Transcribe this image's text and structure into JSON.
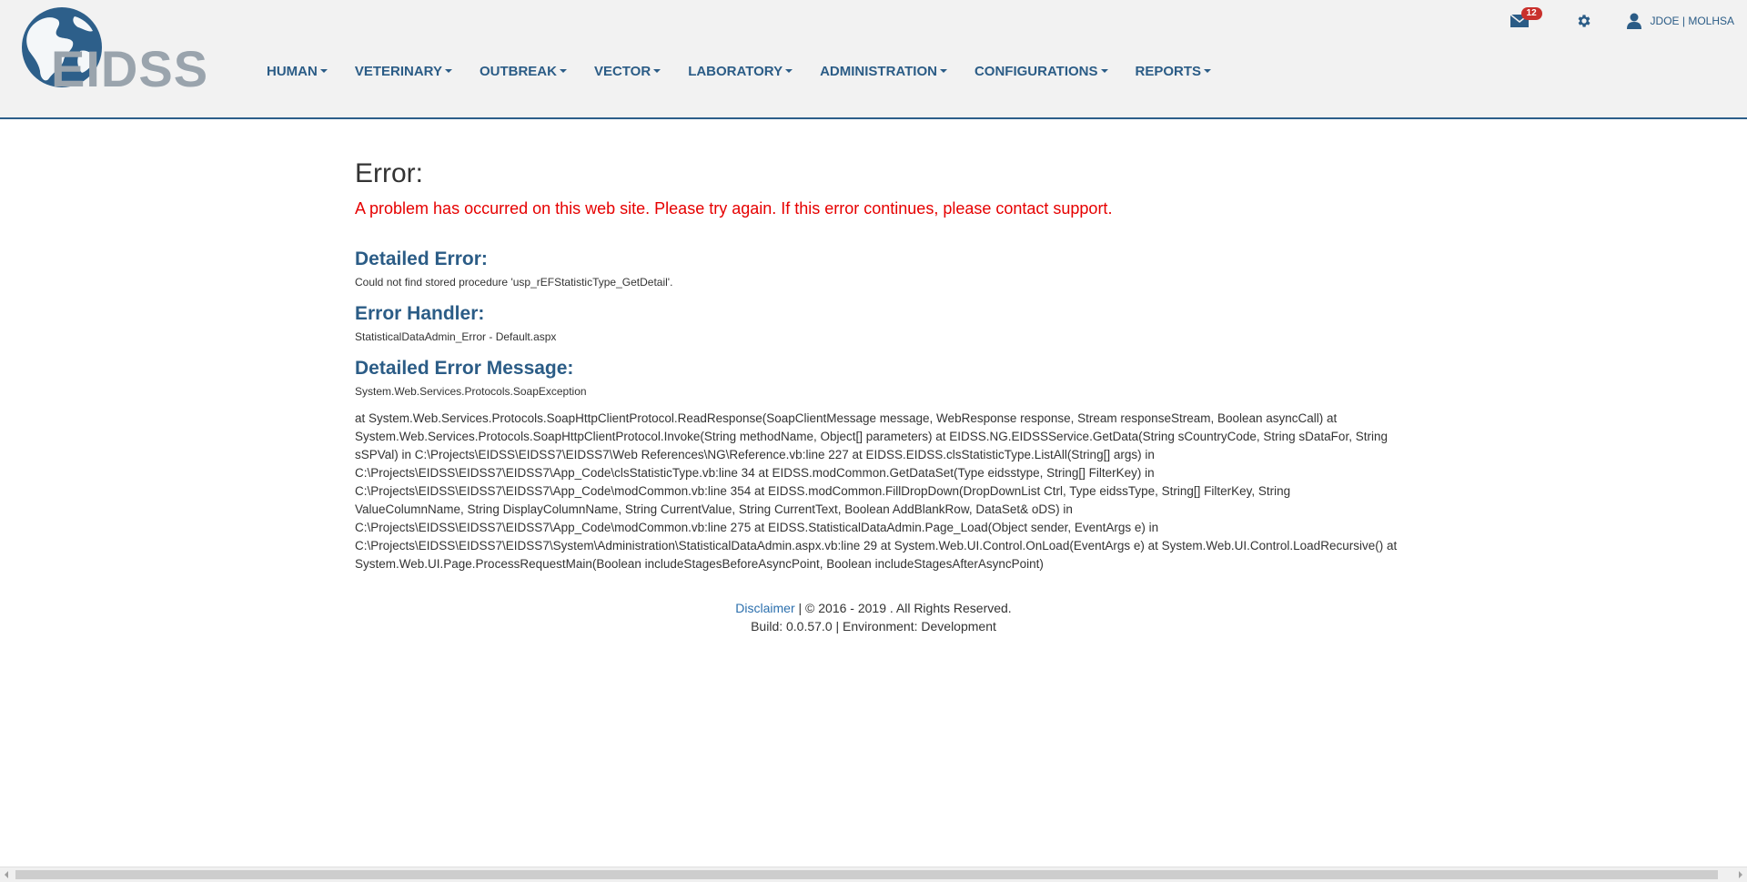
{
  "app": {
    "logo_text": "EIDSS"
  },
  "nav": {
    "items": [
      {
        "label": "HUMAN"
      },
      {
        "label": "VETERINARY"
      },
      {
        "label": "OUTBREAK"
      },
      {
        "label": "VECTOR"
      },
      {
        "label": "LABORATORY"
      },
      {
        "label": "ADMINISTRATION"
      },
      {
        "label": "CONFIGURATIONS"
      },
      {
        "label": "REPORTS"
      }
    ]
  },
  "topbar": {
    "mail_badge": "12",
    "user_label": "JDOE | MOLHSA"
  },
  "error": {
    "title": "Error:",
    "message": "A problem has occurred on this web site. Please try again. If this error continues, please contact support.",
    "detailed_error_heading": "Detailed Error:",
    "detailed_error_text": "Could not find stored procedure 'usp_rEFStatisticType_GetDetail'.",
    "handler_heading": "Error Handler:",
    "handler_text": "StatisticalDataAdmin_Error - Default.aspx",
    "detailed_message_heading": "Detailed Error Message:",
    "detailed_message_type": "System.Web.Services.Protocols.SoapException",
    "stack_trace": "at System.Web.Services.Protocols.SoapHttpClientProtocol.ReadResponse(SoapClientMessage message, WebResponse response, Stream responseStream, Boolean asyncCall) at System.Web.Services.Protocols.SoapHttpClientProtocol.Invoke(String methodName, Object[] parameters) at EIDSS.NG.EIDSSService.GetData(String sCountryCode, String sDataFor, String sSPVal) in C:\\Projects\\EIDSS\\EIDSS7\\EIDSS7\\Web References\\NG\\Reference.vb:line 227 at EIDSS.EIDSS.clsStatisticType.ListAll(String[] args) in C:\\Projects\\EIDSS\\EIDSS7\\EIDSS7\\App_Code\\clsStatisticType.vb:line 34 at EIDSS.modCommon.GetDataSet(Type eidsstype, String[] FilterKey) in C:\\Projects\\EIDSS\\EIDSS7\\EIDSS7\\App_Code\\modCommon.vb:line 354 at EIDSS.modCommon.FillDropDown(DropDownList Ctrl, Type eidssType, String[] FilterKey, String ValueColumnName, String DisplayColumnName, String CurrentValue, String CurrentText, Boolean AddBlankRow, DataSet& oDS) in C:\\Projects\\EIDSS\\EIDSS7\\EIDSS7\\App_Code\\modCommon.vb:line 275 at EIDSS.StatisticalDataAdmin.Page_Load(Object sender, EventArgs e) in C:\\Projects\\EIDSS\\EIDSS7\\EIDSS7\\System\\Administration\\StatisticalDataAdmin.aspx.vb:line 29 at System.Web.UI.Control.OnLoad(EventArgs e) at System.Web.UI.Control.LoadRecursive() at System.Web.UI.Page.ProcessRequestMain(Boolean includeStagesBeforeAsyncPoint, Boolean includeStagesAfterAsyncPoint)"
  },
  "footer": {
    "disclaimer_link": "Disclaimer",
    "copyright": " | © 2016 - 2019 . All Rights Reserved.",
    "build_line": "Build: 0.0.57.0 | Environment: Development"
  },
  "colors": {
    "brand_blue": "#2b5c86",
    "error_red": "#e60000",
    "header_bg": "#f2f2f2",
    "badge_red": "#c9302c"
  },
  "icons": [
    "globe-logo-icon",
    "mail-icon",
    "gear-icon",
    "user-icon",
    "caret-down-icon"
  ]
}
